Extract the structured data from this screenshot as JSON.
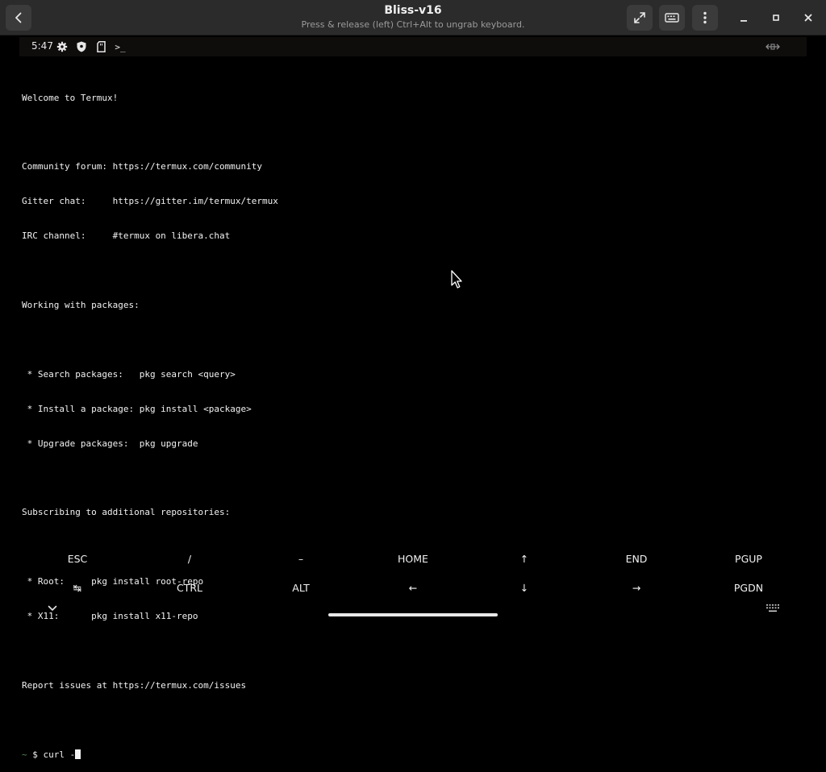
{
  "window": {
    "title": "Bliss-v16",
    "subtitle": "Press & release (left) Ctrl+Alt to ungrab keyboard."
  },
  "headerbar_icons": {
    "back": "chevron-left-icon",
    "fullscreen": "fullscreen-icon",
    "keyboard": "keyboard-icon",
    "menu": "kebab-menu-icon",
    "minimize": "minimize-icon",
    "maximize": "maximize-icon",
    "close": "close-icon"
  },
  "statusbar": {
    "time": "5:47",
    "icons": [
      "gear-icon",
      "shield-icon",
      "sd-card-icon",
      "terminal-icon",
      "rotate-icon"
    ],
    "terminal_glyph": ">_"
  },
  "terminal": {
    "lines": [
      "Welcome to Termux!",
      "",
      "Community forum: https://termux.com/community",
      "Gitter chat:     https://gitter.im/termux/termux",
      "IRC channel:     #termux on libera.chat",
      "",
      "Working with packages:",
      "",
      " * Search packages:   pkg search <query>",
      " * Install a package: pkg install <package>",
      " * Upgrade packages:  pkg upgrade",
      "",
      "Subscribing to additional repositories:",
      "",
      " * Root:     pkg install root-repo",
      " * X11:      pkg install x11-repo",
      "",
      "Report issues at https://termux.com/issues",
      ""
    ],
    "prompt_prefix": "~",
    "prompt": " $ curl -"
  },
  "extra_keys": {
    "row1": [
      "ESC",
      "/",
      "–",
      "HOME",
      "↑",
      "END",
      "PGUP"
    ],
    "row2": [
      "↹",
      "CTRL",
      "ALT",
      "←",
      "↓",
      "→",
      "PGDN"
    ]
  },
  "colors": {
    "headerbar": "#2b2b2b",
    "terminal_bg": "#000000",
    "terminal_fg": "#f2f2f2",
    "statusbar_bg": "#0f0c0c"
  }
}
